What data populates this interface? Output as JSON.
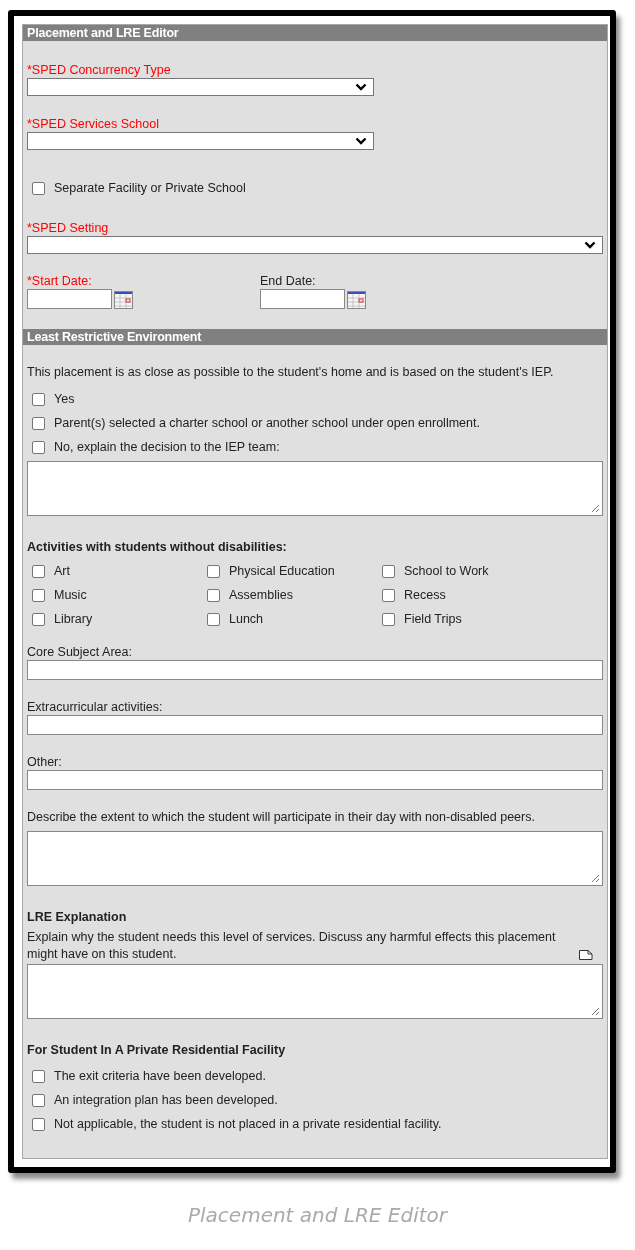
{
  "sections": [
    {
      "title": "Placement and LRE Editor",
      "fields": [
        {
          "kind": "select",
          "label": "*SPED Concurrency Type",
          "required": true,
          "wide": false
        },
        {
          "kind": "select",
          "label": "*SPED Services School",
          "required": true,
          "wide": false
        },
        {
          "kind": "checkbox",
          "label": "Separate Facility or Private School",
          "checked": false
        },
        {
          "kind": "select",
          "label": "*SPED Setting",
          "required": true,
          "wide": true
        },
        {
          "kind": "dates",
          "items": [
            {
              "label": "*Start Date:",
              "required": true
            },
            {
              "label": "End Date:",
              "required": false
            }
          ]
        }
      ]
    },
    {
      "title": "Least Restrictive Environment",
      "fields": [
        {
          "kind": "text",
          "text": "This placement is as close as possible to the student's home and is based on the student's IEP."
        },
        {
          "kind": "checkbox",
          "label": "Yes",
          "checked": false
        },
        {
          "kind": "checkbox",
          "label": "Parent(s) selected a charter school or another school under open enrollment.",
          "checked": false
        },
        {
          "kind": "checkbox",
          "label": "No, explain the decision to the IEP team:",
          "checked": false
        },
        {
          "kind": "textarea"
        },
        {
          "kind": "heading",
          "text": "Activities with students without disabilities:"
        },
        {
          "kind": "grid",
          "items": [
            {
              "label": "Art",
              "checked": false
            },
            {
              "label": "Physical Education",
              "checked": false
            },
            {
              "label": "School to Work",
              "checked": false
            },
            {
              "label": "Music",
              "checked": false
            },
            {
              "label": "Assemblies",
              "checked": false
            },
            {
              "label": "Recess",
              "checked": false
            },
            {
              "label": "Library",
              "checked": false
            },
            {
              "label": "Lunch",
              "checked": false
            },
            {
              "label": "Field Trips",
              "checked": false
            }
          ]
        },
        {
          "kind": "input",
          "label": "Core Subject Area:"
        },
        {
          "kind": "input",
          "label": "Extracurricular activities:"
        },
        {
          "kind": "input",
          "label": "Other:"
        },
        {
          "kind": "textarea",
          "label": "Describe the extent to which the student will participate in their day with non-disabled peers."
        },
        {
          "kind": "heading",
          "text": "LRE Explanation"
        },
        {
          "kind": "note_textarea",
          "label": "Explain why the student needs this level of services. Discuss any harmful effects this placement might have on this student."
        },
        {
          "kind": "heading",
          "text": "For Student In A Private Residential Facility"
        },
        {
          "kind": "checkbox",
          "label": "The exit criteria have been developed.",
          "checked": false
        },
        {
          "kind": "checkbox",
          "label": "An integration plan has been developed.",
          "checked": false
        },
        {
          "kind": "checkbox",
          "label": "Not applicable, the student is not placed in a private residential facility.",
          "checked": false
        }
      ]
    }
  ],
  "caption": "Placement and LRE Editor"
}
